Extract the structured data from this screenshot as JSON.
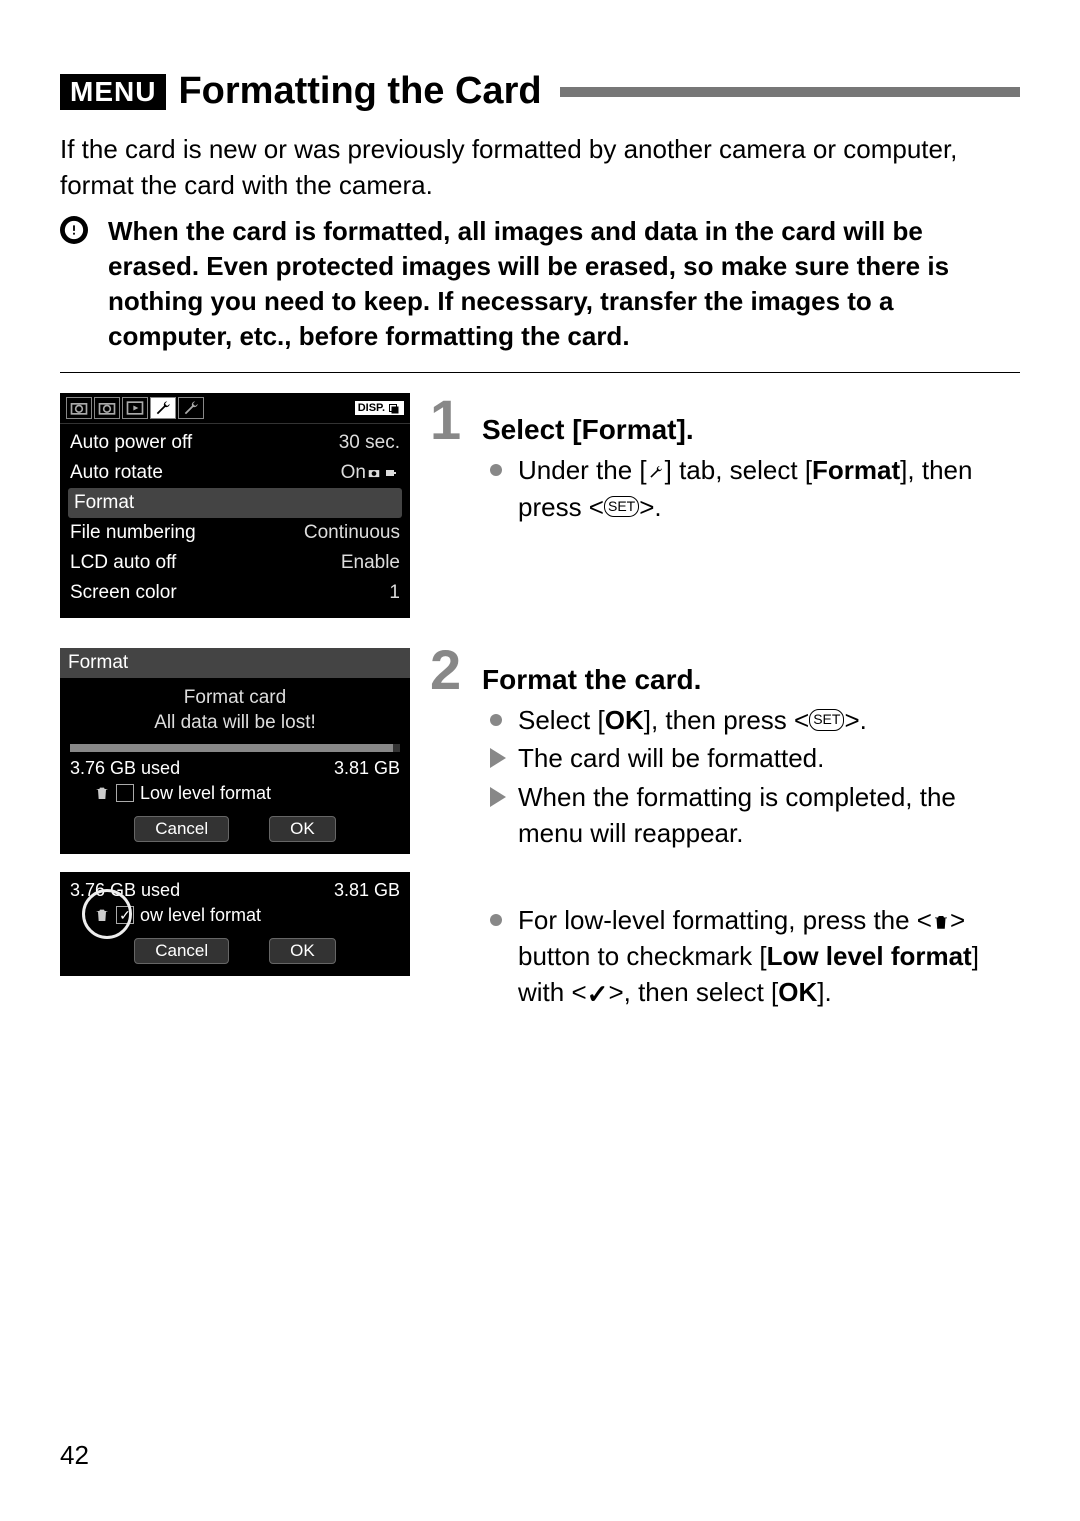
{
  "header": {
    "menu_label": "MENU",
    "title": "Formatting the Card"
  },
  "intro": "If the card is new or was previously formatted by another camera or computer, format the card with the camera.",
  "warning": "When the card is formatted, all images and data in the card will be erased. Even protected images will be erased, so make sure there is nothing you need to keep. If necessary, transfer the images to a computer, etc., before formatting the card.",
  "screen1": {
    "disp_label": "DISP.",
    "items": [
      {
        "label": "Auto power off",
        "value": "30 sec."
      },
      {
        "label": "Auto rotate",
        "value": "On"
      },
      {
        "label": "Format",
        "value": "",
        "selected": true
      },
      {
        "label": "File numbering",
        "value": "Continuous"
      },
      {
        "label": "LCD auto off",
        "value": "Enable"
      },
      {
        "label": "Screen color",
        "value": "1"
      }
    ]
  },
  "screen2": {
    "header": "Format",
    "line1": "Format card",
    "line2": "All data will be lost!",
    "used": "3.76 GB used",
    "total": "3.81 GB",
    "llf": "Low level format",
    "cancel": "Cancel",
    "ok": "OK"
  },
  "screen3": {
    "used": "3.76 GB used",
    "total": "3.81 GB",
    "llf": "ow level format",
    "cancel": "Cancel",
    "ok": "OK"
  },
  "steps": {
    "s1": {
      "num": "1",
      "title": "Select [Format].",
      "li1a": "Under the [",
      "li1b": "] tab, select [",
      "li1bold": "Format",
      "li1c": "], then press <",
      "li1set": "SET",
      "li1d": ">."
    },
    "s2": {
      "num": "2",
      "title": "Format the card.",
      "li1a": "Select [",
      "li1bold": "OK",
      "li1b": "], then press <",
      "li1set": "SET",
      "li1c": ">.",
      "li2": "The card will be formatted.",
      "li3": "When the formatting is completed, the menu will reappear."
    },
    "s3": {
      "li1a": "For low-level formatting, press the <",
      "li1b": "> button to checkmark [",
      "li1bold": "Low level format",
      "li1c": "] with <",
      "li1check": "✓",
      "li1d": ">, then select [",
      "li1bold2": "OK",
      "li1e": "]."
    }
  },
  "page_number": "42"
}
